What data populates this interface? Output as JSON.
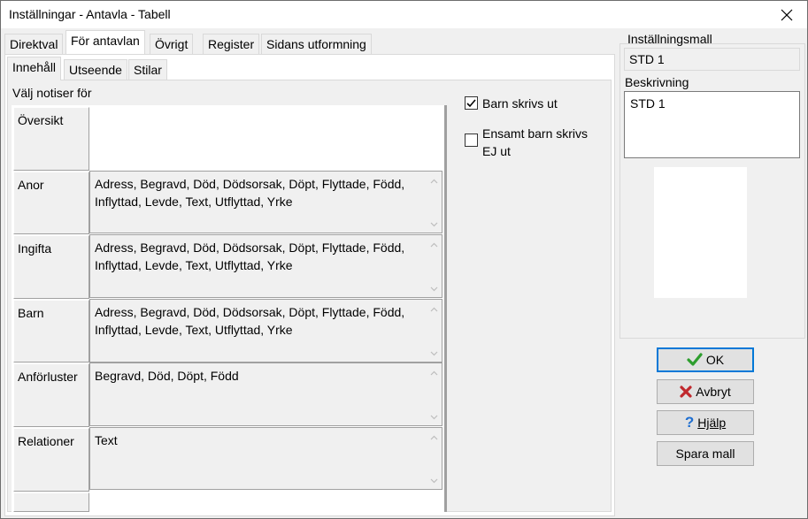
{
  "window": {
    "title": "Inställningar - Antavla - Tabell"
  },
  "tabs": [
    {
      "label": "Direktval"
    },
    {
      "label": "För antavlan"
    },
    {
      "label": "Övrigt"
    },
    {
      "label": "Register"
    },
    {
      "label": "Sidans utformning"
    }
  ],
  "subtabs": [
    {
      "label": "Innehåll"
    },
    {
      "label": "Utseende"
    },
    {
      "label": "Stilar"
    }
  ],
  "content": {
    "select_label": "Välj notiser för",
    "rows": [
      {
        "label": "Översikt",
        "value": ""
      },
      {
        "label": "Anor",
        "value": "Adress, Begravd, Död, Dödsorsak, Döpt, Flyttade, Född, Inflyttad, Levde, Text, Utflyttad, Yrke"
      },
      {
        "label": "Ingifta",
        "value": "Adress, Begravd, Död, Dödsorsak, Döpt, Flyttade, Född, Inflyttad, Levde, Text, Utflyttad, Yrke"
      },
      {
        "label": "Barn",
        "value": "Adress, Begravd, Död, Dödsorsak, Döpt, Flyttade, Född, Inflyttad, Levde, Text, Utflyttad, Yrke"
      },
      {
        "label": "Anförluster",
        "value": "Begravd, Död, Döpt, Född"
      },
      {
        "label": "Relationer",
        "value": "Text"
      }
    ],
    "checkboxes": [
      {
        "label": "Barn skrivs ut",
        "checked": true
      },
      {
        "label": "Ensamt barn skrivs EJ ut",
        "checked": false
      }
    ]
  },
  "sidebar": {
    "template_label": "Inställningsmall",
    "template_value": "STD 1",
    "description_label": "Beskrivning",
    "description_value": "STD 1"
  },
  "buttons": {
    "ok": "OK",
    "cancel": "Avbryt",
    "help": "Hjälp",
    "save": "Spara mall"
  },
  "colors": {
    "focus": "#0078d7",
    "ok_green": "#2e9e2e",
    "cancel_red": "#c0282d",
    "help_blue": "#1f6fd1"
  }
}
